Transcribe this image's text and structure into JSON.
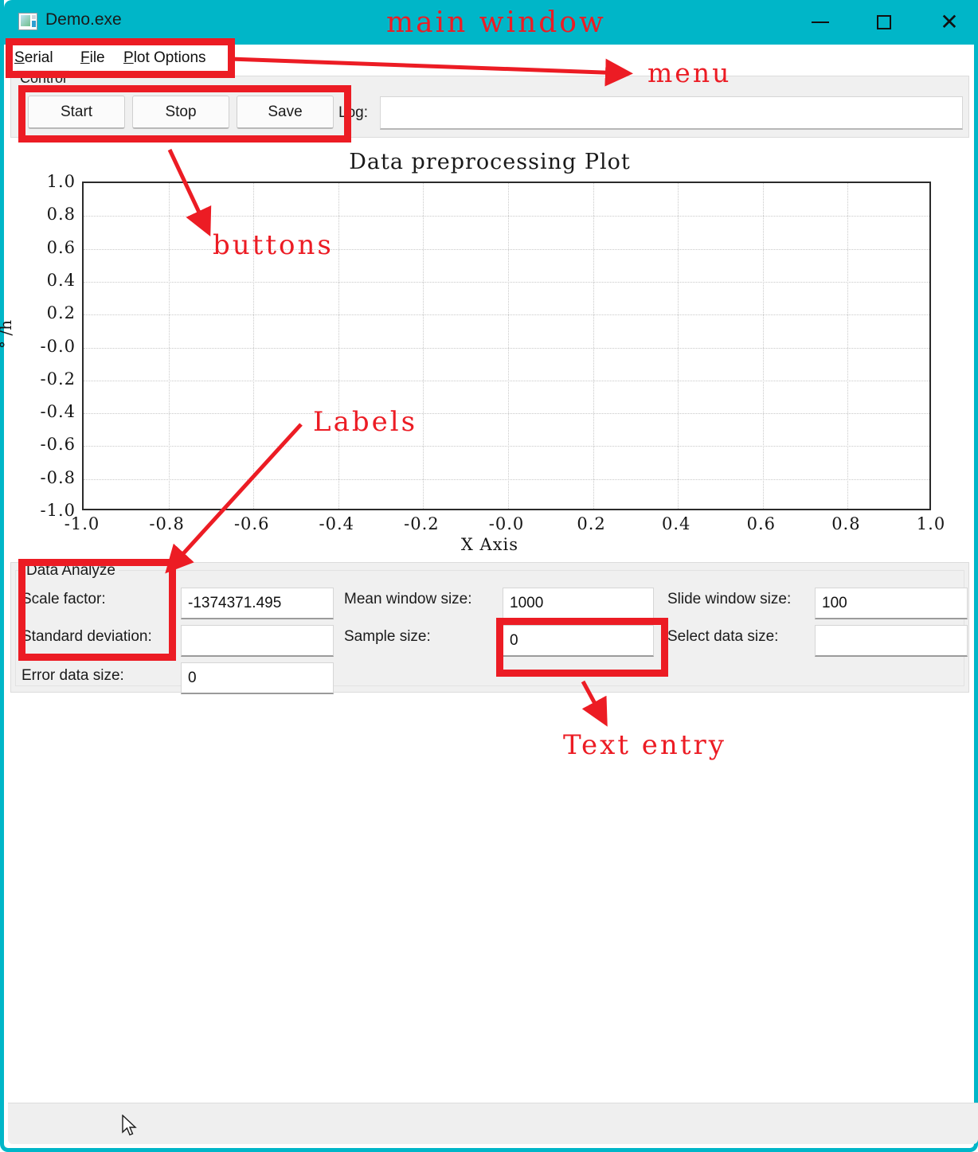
{
  "window": {
    "title": "Demo.exe",
    "icon": "app-window-icon",
    "controls": {
      "minimize": "–",
      "maximize": "□",
      "close": "✕"
    },
    "accent_color": "#00b6c8"
  },
  "menubar": {
    "items": [
      {
        "label": "Serial",
        "accel": "S",
        "rest": "erial"
      },
      {
        "label": "File",
        "accel": "F",
        "rest": "ile"
      },
      {
        "label": "Plot Options",
        "accel": "P",
        "rest": "lot Options"
      }
    ]
  },
  "control_group": {
    "legend": "Control",
    "buttons": [
      {
        "label": "Start",
        "name": "start-button"
      },
      {
        "label": "Stop",
        "name": "stop-button"
      },
      {
        "label": "Save",
        "name": "save-button"
      }
    ],
    "log": {
      "label": "Log:",
      "value": "",
      "placeholder": ""
    }
  },
  "chart_data": {
    "type": "line",
    "title": "Data preprocessing Plot",
    "xlabel": "X Axis",
    "ylabel": "° /h",
    "xlim": [
      -1.0,
      1.0
    ],
    "ylim": [
      -1.0,
      1.0
    ],
    "grid": true,
    "legend": "none",
    "series": [],
    "xticks": [
      "-1.0",
      "-0.8",
      "-0.6",
      "-0.4",
      "-0.2",
      "-0.0",
      "0.2",
      "0.4",
      "0.6",
      "0.8",
      "1.0"
    ],
    "yticks": [
      "1.0",
      "0.8",
      "0.6",
      "0.4",
      "0.2",
      "-0.0",
      "-0.2",
      "-0.4",
      "-0.6",
      "-0.8",
      "-1.0"
    ]
  },
  "analyze_group": {
    "legend": "Data Analyze",
    "fields": [
      {
        "label": "Scale factor:",
        "value": "-1374371.495",
        "name": "scale-factor"
      },
      {
        "label": "Standard deviation:",
        "value": "",
        "name": "standard-deviation"
      },
      {
        "label": "Error data size:",
        "value": "0",
        "name": "error-data-size"
      },
      {
        "label": "Mean window size:",
        "value": "1000",
        "name": "mean-window-size"
      },
      {
        "label": "Sample size:",
        "value": "0",
        "name": "sample-size"
      },
      {
        "label": "Slide window size:",
        "value": "100",
        "name": "slide-window-size"
      },
      {
        "label": "Select data size:",
        "value": "",
        "name": "select-data-size"
      }
    ]
  },
  "annotations": {
    "color": "#ec1c24",
    "labels": [
      {
        "text": "main window",
        "target": "titlebar"
      },
      {
        "text": "menu",
        "target": "menubar"
      },
      {
        "text": "buttons",
        "target": "control-buttons"
      },
      {
        "text": "Labels",
        "target": "analyze-labels"
      },
      {
        "text": "Text entry",
        "target": "sample-size-input"
      }
    ]
  },
  "statusbar": {
    "text": ""
  }
}
